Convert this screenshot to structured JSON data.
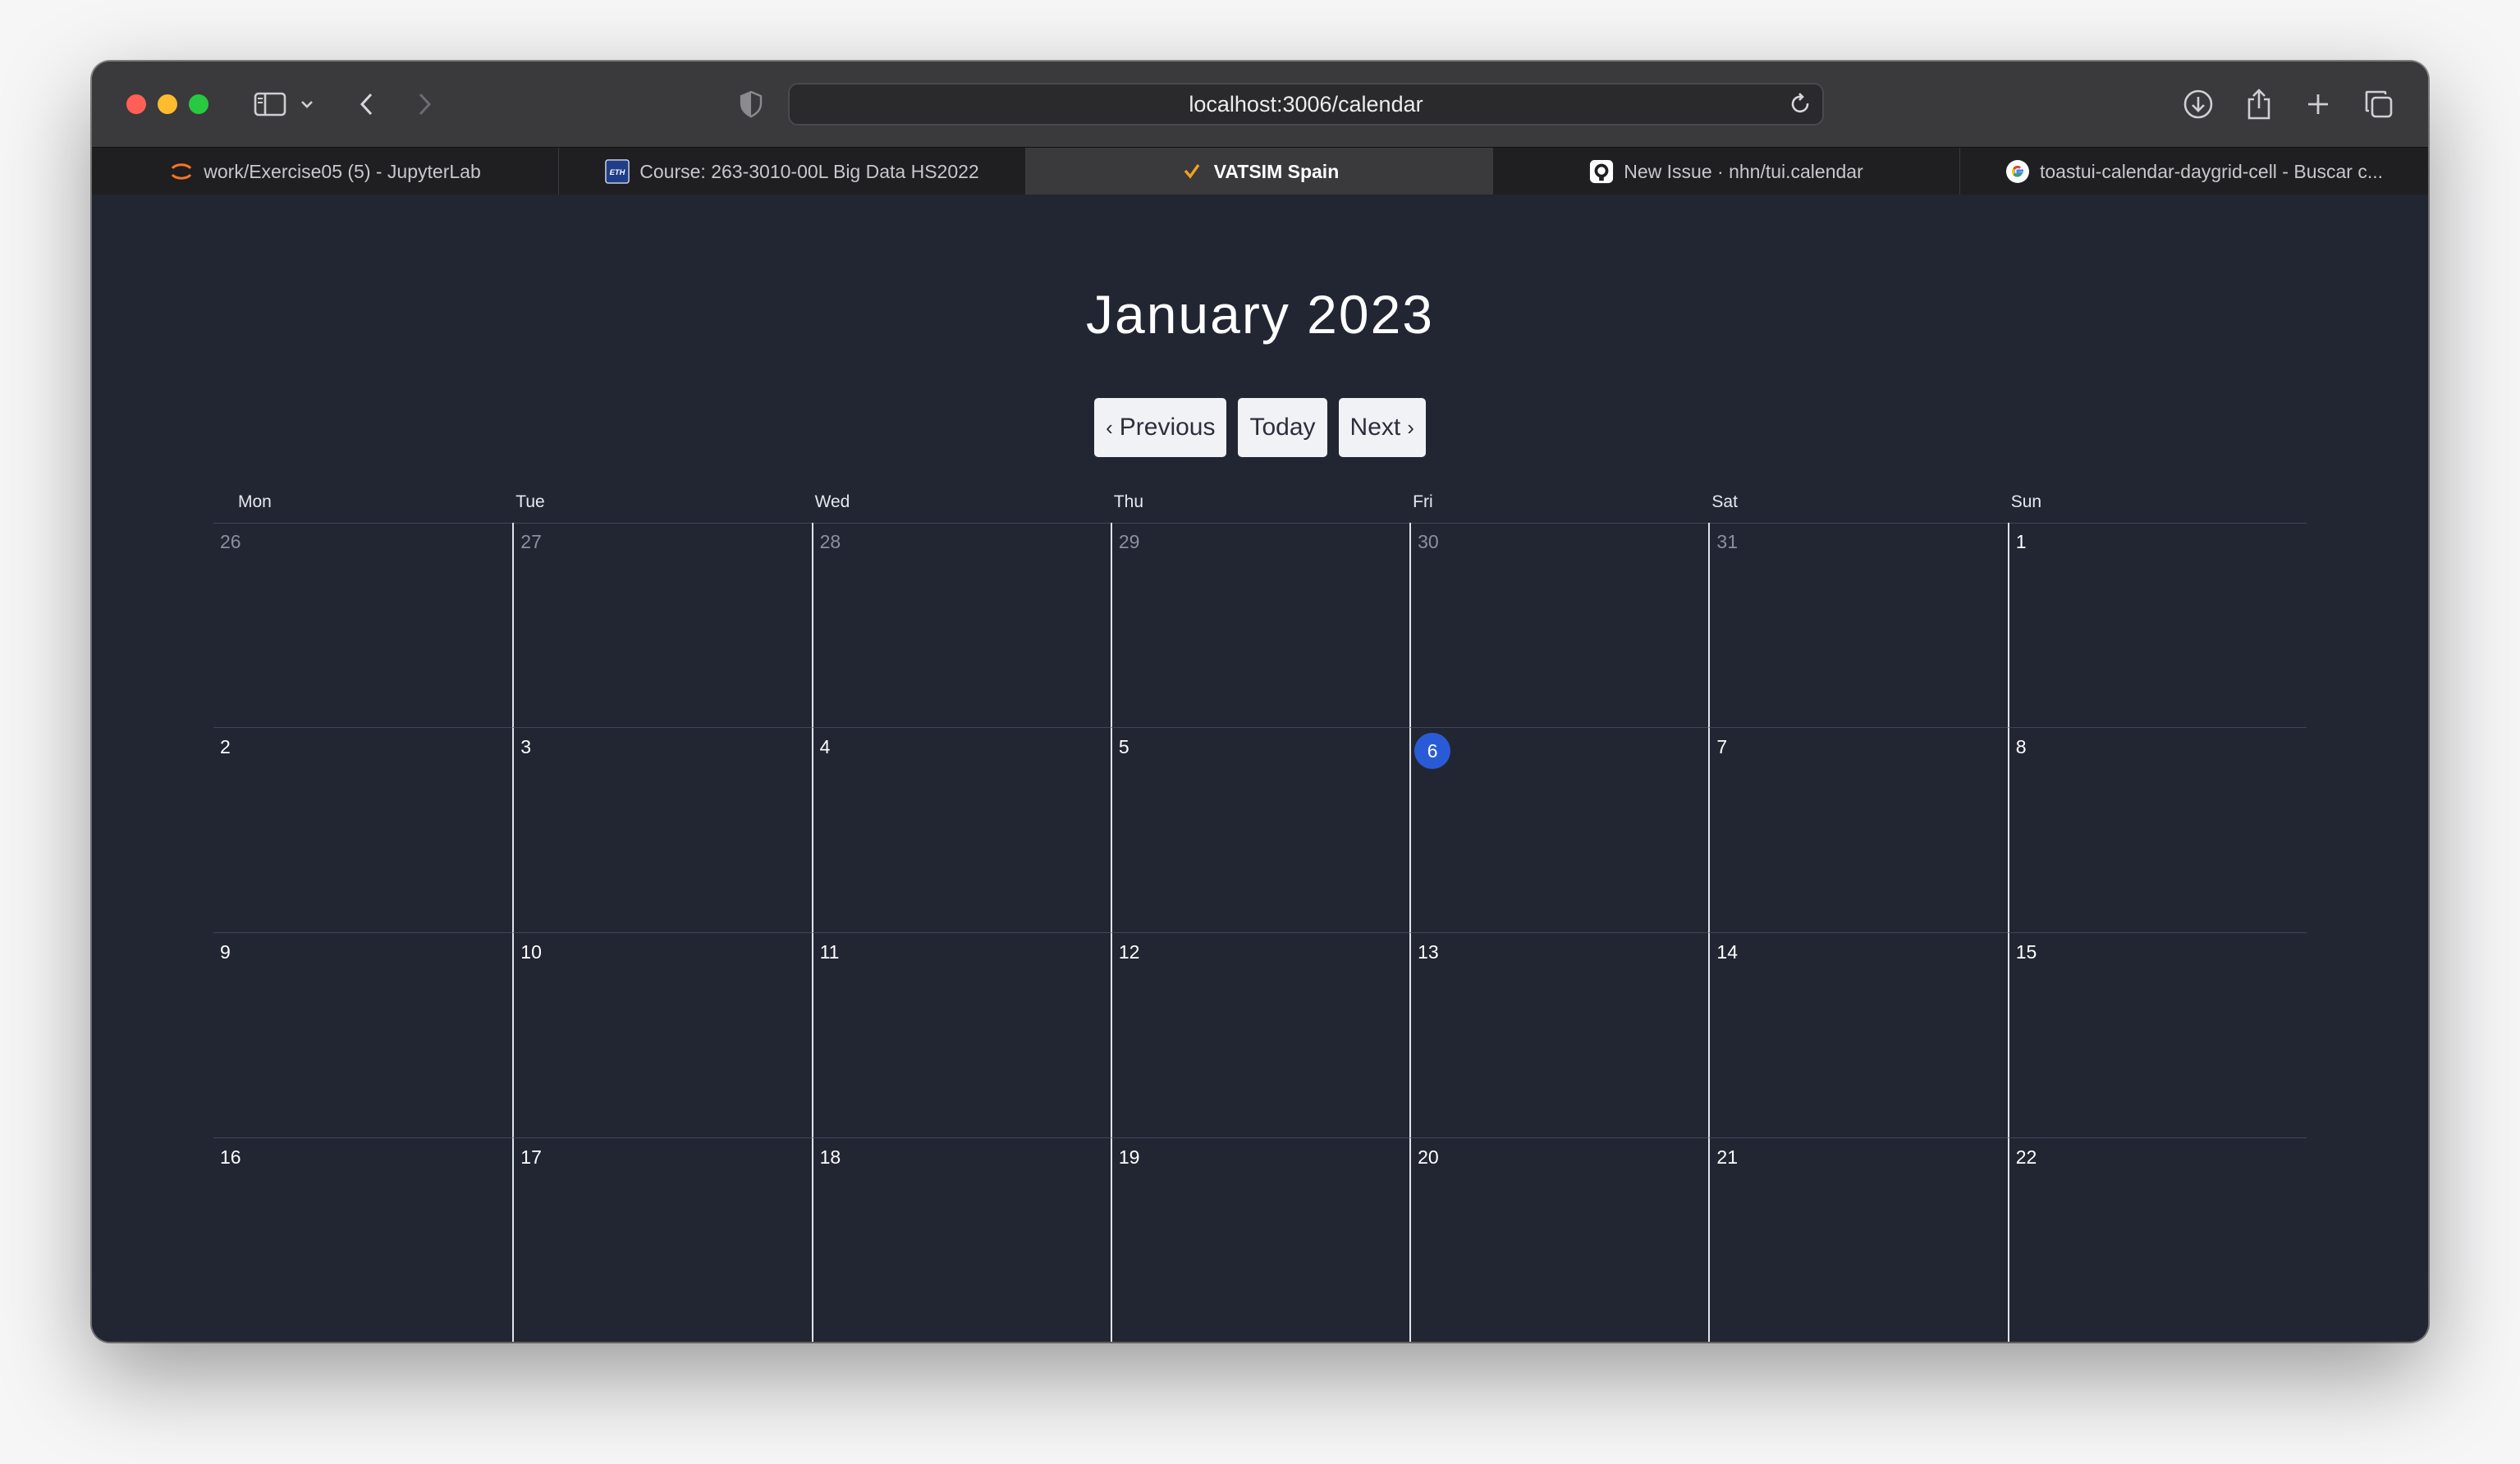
{
  "browser": {
    "url": "localhost:3006/calendar",
    "tabs": [
      {
        "label": "work/Exercise05 (5) - JupyterLab",
        "icon": "jupyter-icon",
        "active": false
      },
      {
        "label": "Course: 263-3010-00L Big Data HS2022",
        "icon": "eth-icon",
        "active": false
      },
      {
        "label": "VATSIM Spain",
        "icon": "vatsim-icon",
        "active": true
      },
      {
        "label": "New Issue · nhn/tui.calendar",
        "icon": "github-icon",
        "active": false
      },
      {
        "label": "toastui-calendar-daygrid-cell - Buscar c...",
        "icon": "google-icon",
        "active": false
      }
    ]
  },
  "calendar": {
    "title": "January 2023",
    "prev_label": "Previous",
    "today_label": "Today",
    "next_label": "Next",
    "weekdays": [
      "Mon",
      "Tue",
      "Wed",
      "Thu",
      "Fri",
      "Sat",
      "Sun"
    ],
    "weeks": [
      [
        {
          "d": "26",
          "other": true
        },
        {
          "d": "27",
          "other": true
        },
        {
          "d": "28",
          "other": true
        },
        {
          "d": "29",
          "other": true
        },
        {
          "d": "30",
          "other": true
        },
        {
          "d": "31",
          "other": true
        },
        {
          "d": "1",
          "other": false
        }
      ],
      [
        {
          "d": "2"
        },
        {
          "d": "3"
        },
        {
          "d": "4"
        },
        {
          "d": "5"
        },
        {
          "d": "6",
          "today": true
        },
        {
          "d": "7"
        },
        {
          "d": "8"
        }
      ],
      [
        {
          "d": "9"
        },
        {
          "d": "10"
        },
        {
          "d": "11"
        },
        {
          "d": "12"
        },
        {
          "d": "13"
        },
        {
          "d": "14"
        },
        {
          "d": "15"
        }
      ],
      [
        {
          "d": "16"
        },
        {
          "d": "17"
        },
        {
          "d": "18"
        },
        {
          "d": "19"
        },
        {
          "d": "20"
        },
        {
          "d": "21"
        },
        {
          "d": "22"
        }
      ]
    ],
    "colors": {
      "background": "#222633",
      "today_highlight": "#2a5bd7",
      "other_month_text": "#8a90a0",
      "grid_line": "#40465a",
      "column_line": "#dfe2ea"
    }
  }
}
